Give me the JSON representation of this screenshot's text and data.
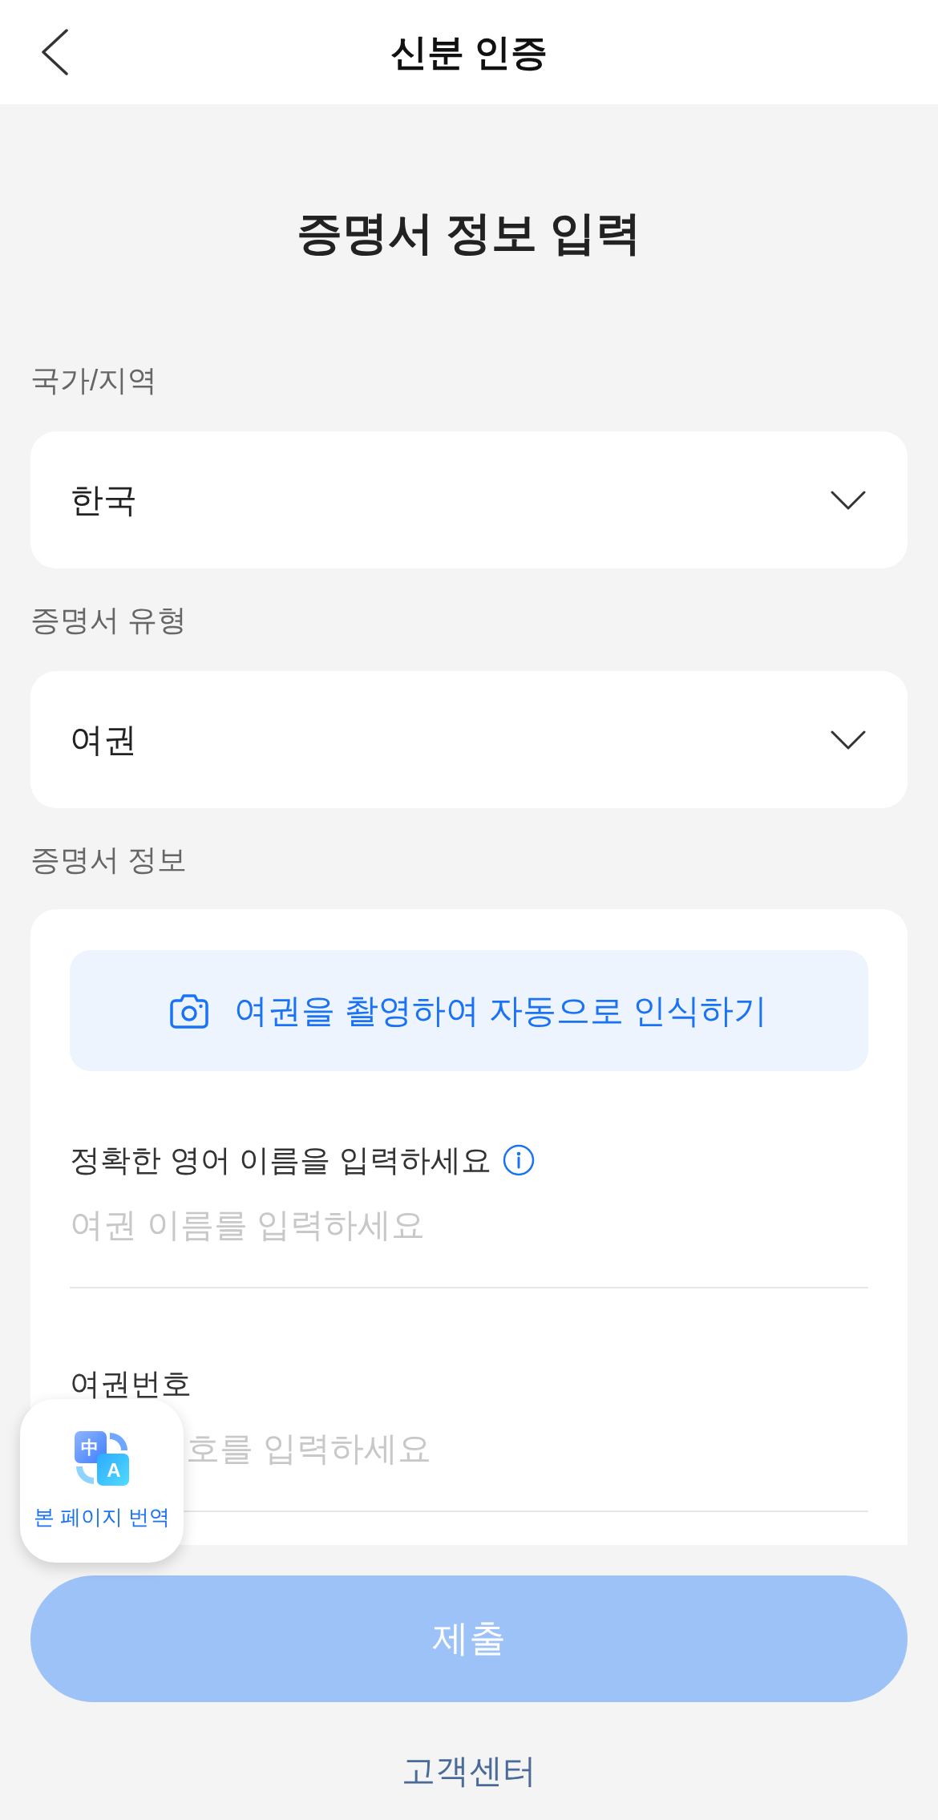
{
  "header": {
    "title": "신분 인증"
  },
  "heading": "증명서 정보 입력",
  "selects": [
    {
      "label": "국가/지역",
      "value": "한국"
    },
    {
      "label": "증명서 유형",
      "value": "여권"
    }
  ],
  "section": {
    "label": "증명서 정보",
    "scan_button": "여권을 촬영하여 자동으로 인식하기",
    "fields": [
      {
        "label": "정확한 영어 이름을 입력하세요",
        "info": true,
        "placeholder": "여권 이름를 입력하세요",
        "covered_by_overlay": false
      },
      {
        "label": "여권번호",
        "info": false,
        "placeholder": "호를 입력하세요",
        "covered_by_overlay": true
      }
    ]
  },
  "translate_widget": {
    "label": "본 페이지 번역",
    "icon_glyphs": [
      "中",
      "A"
    ]
  },
  "submit": {
    "label": "제출",
    "disabled": true
  },
  "customer_center": "고객센터"
}
